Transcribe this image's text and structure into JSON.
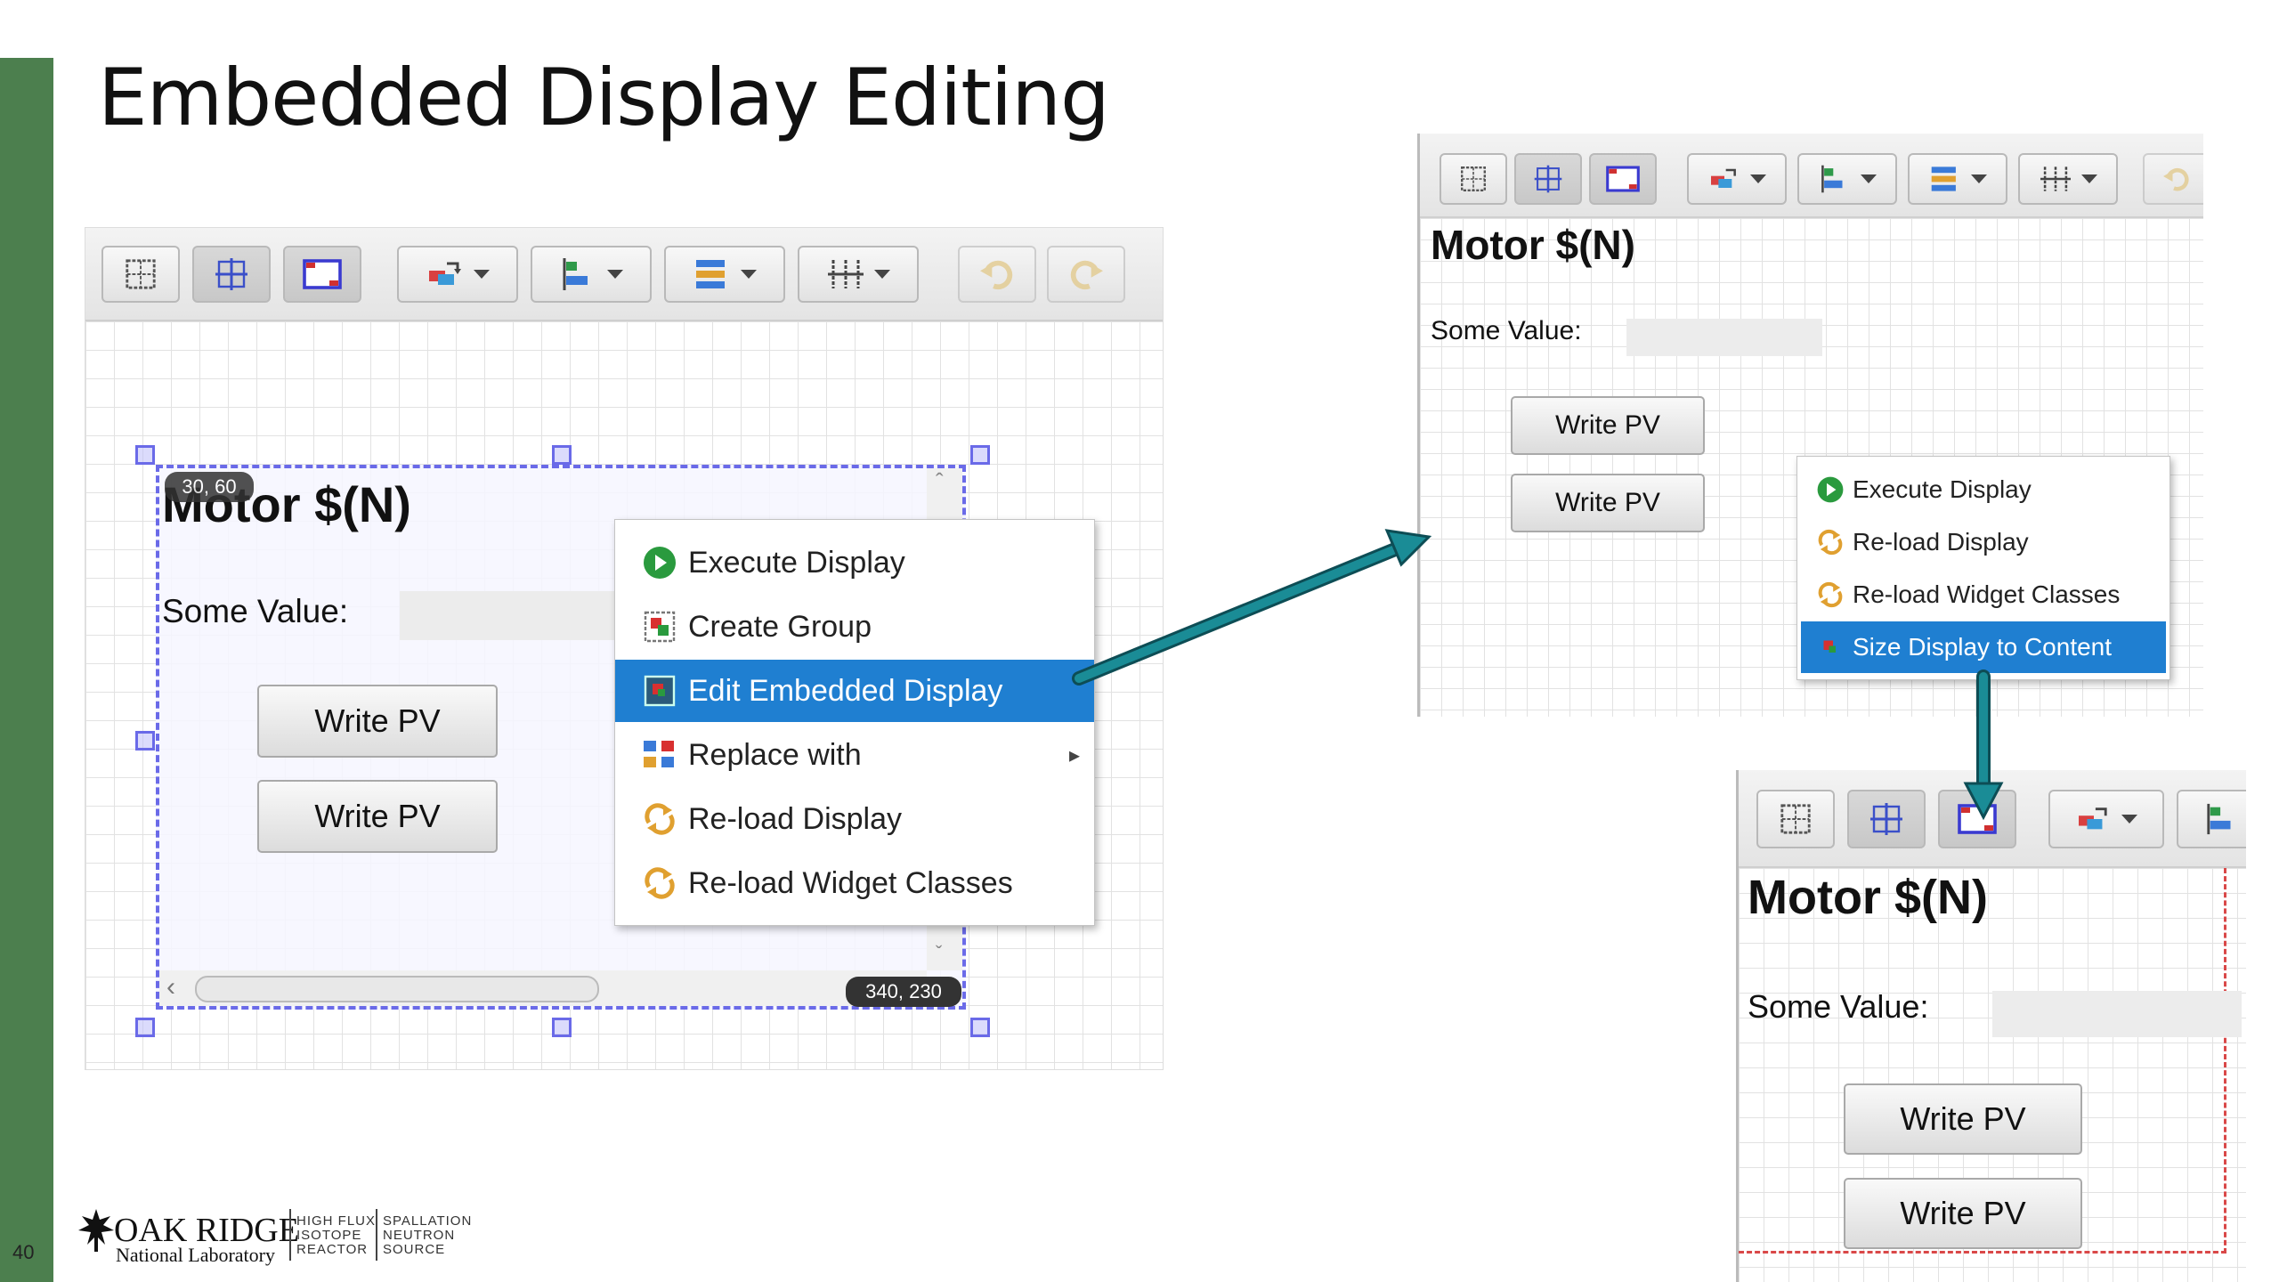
{
  "slide": {
    "title": "Embedded Display Editing",
    "number": "40",
    "accent_color": "#4c7f4e"
  },
  "toolbar_icons": [
    "grid-icon",
    "snap-icon",
    "coordinates-icon",
    "order-icon",
    "align-icon",
    "distribute-icon",
    "size-icon",
    "undo-icon",
    "redo-icon"
  ],
  "left_panel": {
    "display_title": "Motor $(N)",
    "label": "Some Value:",
    "buttons": [
      "Write PV",
      "Write PV"
    ],
    "coord_top_left": "30, 60",
    "coord_bottom_right": "340, 230",
    "context_menu": [
      {
        "label": "Execute Display",
        "icon": "execute-icon"
      },
      {
        "label": "Create Group",
        "icon": "group-icon"
      },
      {
        "label": "Edit Embedded Display",
        "icon": "edit-embedded-icon",
        "selected": true
      },
      {
        "label": "Replace with",
        "icon": "replace-icon",
        "submenu": true
      },
      {
        "label": "Re-load Display",
        "icon": "reload-icon"
      },
      {
        "label": "Re-load Widget Classes",
        "icon": "reload-classes-icon"
      }
    ]
  },
  "top_right_panel": {
    "display_title": "Motor $(N)",
    "label": "Some Value:",
    "buttons": [
      "Write PV",
      "Write PV"
    ],
    "context_menu": [
      {
        "label": "Execute Display",
        "icon": "execute-icon"
      },
      {
        "label": "Re-load Display",
        "icon": "reload-icon"
      },
      {
        "label": "Re-load Widget Classes",
        "icon": "reload-classes-icon"
      },
      {
        "label": "Size Display to Content",
        "icon": "size-to-content-icon",
        "selected": true
      }
    ]
  },
  "bottom_right_panel": {
    "display_title": "Motor $(N)",
    "label": "Some Value:",
    "buttons": [
      "Write PV",
      "Write PV"
    ]
  },
  "logo": {
    "name": "OAK RIDGE",
    "subtitle": "National Laboratory",
    "col1": [
      "HIGH FLUX",
      "ISOTOPE",
      "REACTOR"
    ],
    "col2": [
      "SPALLATION",
      "NEUTRON",
      "SOURCE"
    ]
  },
  "colors": {
    "menu_selection": "#1f7fd1",
    "selection_handles": "#6a6ae8",
    "arrow": "#1a8c96",
    "content_boundary": "#d94848"
  }
}
